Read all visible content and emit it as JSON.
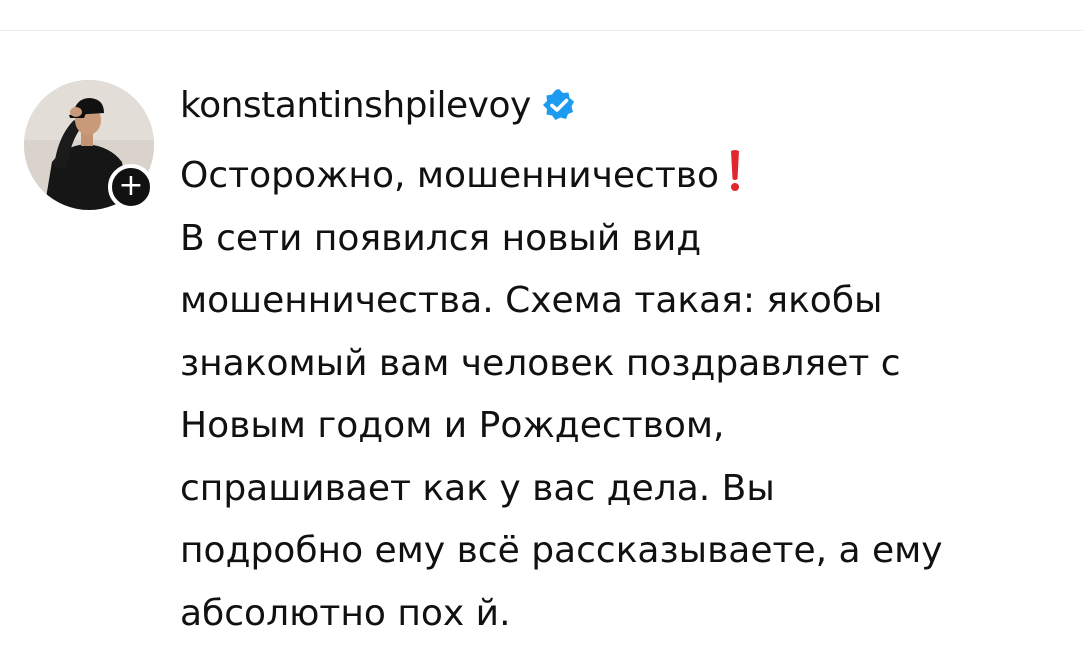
{
  "post": {
    "username": "konstantinshpilevoy",
    "avatar_icon": "avatar-photo",
    "follow_icon": "plus-icon",
    "follow_symbol": "+",
    "verified_icon": "verified-badge-icon",
    "verified_color": "#1d9bf0",
    "caption_lines": [
      "Осторожно, мошенничество",
      "В сети появился новый вид",
      "мошенничества. Схема такая: якобы",
      "знакомый вам человек поздравляет с",
      "Новым годом и Рождеством,",
      "спрашивает как у вас дела. Вы",
      "подробно ему всё рассказываете, а ему",
      "абсолютно пох  й."
    ],
    "emoji_icon": "red-exclamation-icon",
    "emoji_color": "#e0262f"
  }
}
